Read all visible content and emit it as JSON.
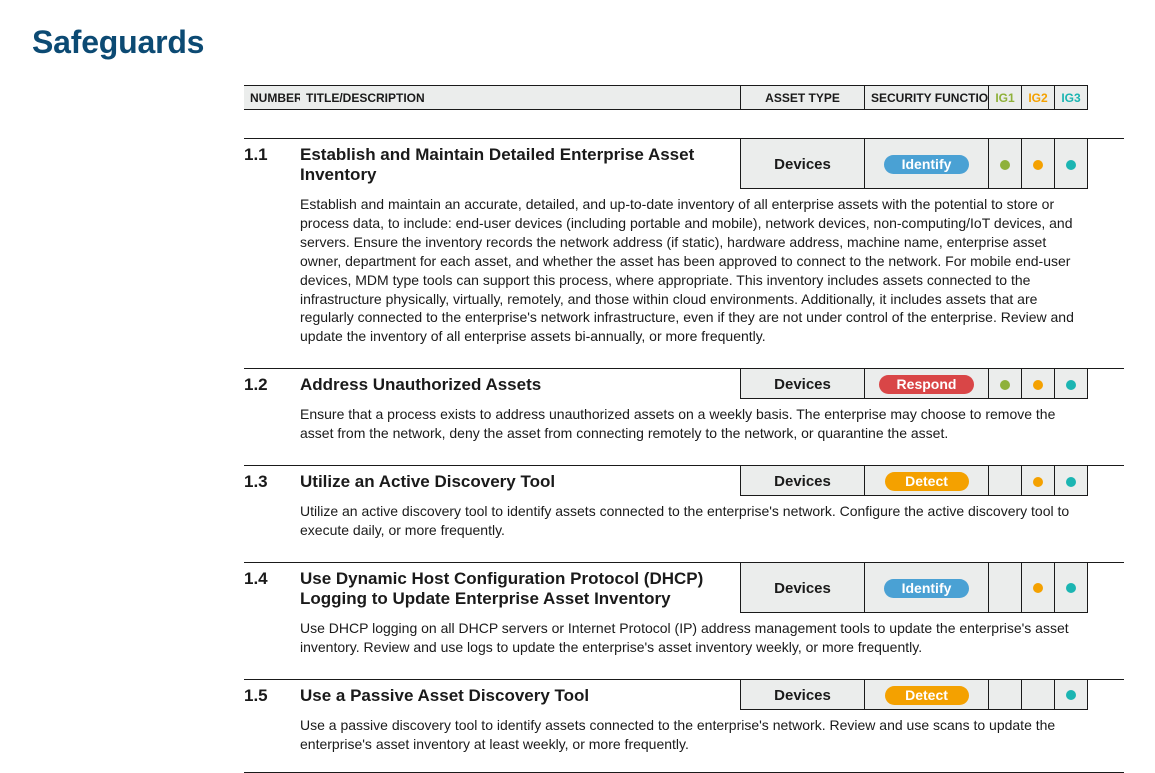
{
  "page_title": "Safeguards",
  "headers": {
    "number": "NUMBER",
    "title": "TITLE/DESCRIPTION",
    "asset_type": "ASSET TYPE",
    "security_function": "SECURITY FUNCTION",
    "ig1": "IG1",
    "ig2": "IG2",
    "ig3": "IG3"
  },
  "colors": {
    "Identify": "#4aa1d4",
    "Respond": "#d94647",
    "Detect": "#f4a100",
    "ig1": "#8fb13a",
    "ig2": "#f4a100",
    "ig3": "#1bb5b2"
  },
  "rows": [
    {
      "num": "1.1",
      "title": "Establish and Maintain Detailed Enterprise Asset Inventory",
      "asset": "Devices",
      "func": "Identify",
      "ig1": true,
      "ig2": true,
      "ig3": true,
      "desc": "Establish and maintain an accurate, detailed, and up-to-date inventory of all enterprise assets with the potential to store or process data, to include: end-user devices (including portable and mobile), network devices, non-computing/IoT devices, and servers. Ensure the inventory records the network address (if static), hardware address, machine name, enterprise asset owner, department for each asset, and whether the asset has been approved to connect to the network. For mobile end-user devices, MDM type tools can support this process, where appropriate. This inventory includes assets connected to the infrastructure physically, virtually, remotely, and those within cloud environments. Additionally, it includes assets that are regularly connected to the enterprise's network infrastructure, even if they are not under control of the enterprise. Review and update the inventory of all enterprise assets bi-annually, or more frequently."
    },
    {
      "num": "1.2",
      "title": "Address Unauthorized Assets",
      "asset": "Devices",
      "func": "Respond",
      "ig1": true,
      "ig2": true,
      "ig3": true,
      "desc": "Ensure that a process exists to address unauthorized assets on a weekly basis. The enterprise may choose to remove the asset from the network, deny the asset from connecting remotely to the network, or quarantine the asset."
    },
    {
      "num": "1.3",
      "title": "Utilize an Active Discovery Tool",
      "asset": "Devices",
      "func": "Detect",
      "ig1": false,
      "ig2": true,
      "ig3": true,
      "desc": "Utilize an active discovery tool to identify assets connected to the enterprise's network. Configure the active discovery tool to execute daily, or more frequently."
    },
    {
      "num": "1.4",
      "title": "Use Dynamic Host Configuration Protocol (DHCP) Logging to Update Enterprise Asset Inventory",
      "asset": "Devices",
      "func": "Identify",
      "ig1": false,
      "ig2": true,
      "ig3": true,
      "desc": "Use DHCP logging on all DHCP servers or Internet Protocol (IP) address management tools to update the enterprise's asset inventory. Review and use logs to update the enterprise's asset inventory weekly, or more frequently."
    },
    {
      "num": "1.5",
      "title": "Use a Passive Asset Discovery Tool",
      "asset": "Devices",
      "func": "Detect",
      "ig1": false,
      "ig2": false,
      "ig3": true,
      "desc": "Use a passive discovery tool to identify assets connected to the enterprise's network. Review and use scans to update the enterprise's asset inventory at least weekly, or more frequently.",
      "last": true
    }
  ]
}
